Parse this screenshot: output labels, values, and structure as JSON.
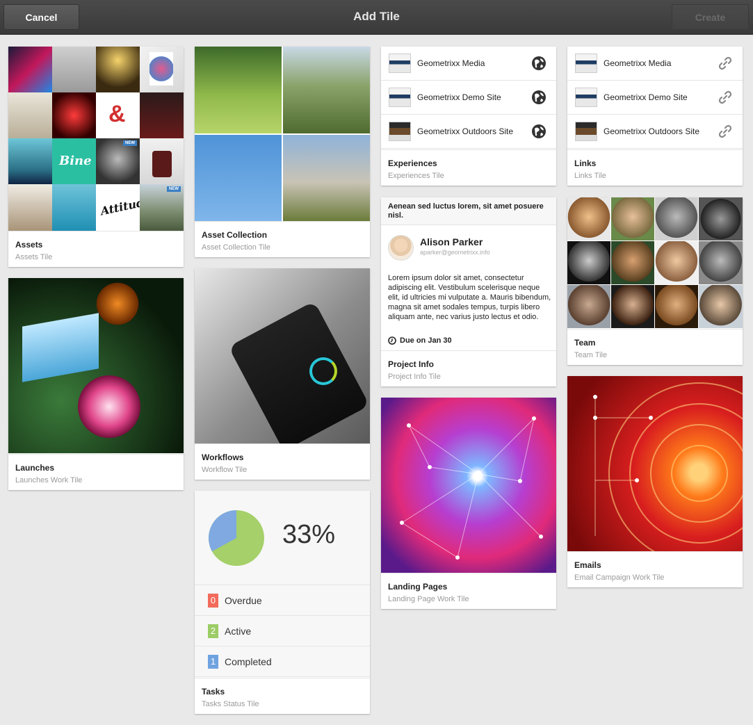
{
  "header": {
    "title": "Add Tile",
    "cancel_label": "Cancel",
    "create_label": "Create"
  },
  "tiles": {
    "assets": {
      "title": "Assets",
      "subtitle": "Assets Tile",
      "badges": [
        "NEW",
        "NEW"
      ]
    },
    "asset_collection": {
      "title": "Asset Collection",
      "subtitle": "Asset Collection Tile"
    },
    "experiences": {
      "title": "Experiences",
      "subtitle": "Experiences Tile",
      "items": [
        {
          "label": "Geometrixx Media",
          "icon": "globe-icon"
        },
        {
          "label": "Geometrixx Demo Site",
          "icon": "globe-icon"
        },
        {
          "label": "Geometrixx Outdoors Site",
          "icon": "globe-icon"
        }
      ]
    },
    "links": {
      "title": "Links",
      "subtitle": "Links Tile",
      "items": [
        {
          "label": "Geometrixx Media",
          "icon": "link-icon"
        },
        {
          "label": "Geometrixx Demo Site",
          "icon": "link-icon"
        },
        {
          "label": "Geometrixx Outdoors Site",
          "icon": "link-icon"
        }
      ]
    },
    "launches": {
      "title": "Launches",
      "subtitle": "Launches Work Tile"
    },
    "workflows": {
      "title": "Workflows",
      "subtitle": "Workflow Tile"
    },
    "project_info": {
      "heading": "Aenean sed luctus lorem, sit amet posuere nisl.",
      "name": "Alison Parker",
      "email": "aparker@geometrixx.info",
      "body": "Lorem ipsum dolor sit amet, consectetur adipiscing elit. Vestibulum scelerisque neque elit, id ultricies mi vulputate a. Mauris bibendum, magna sit amet sodales tempus, turpis libero aliquam ante, nec varius justo lectus et odio.",
      "due": "Due on Jan 30",
      "title": "Project Info",
      "subtitle": "Project Info Tile"
    },
    "team": {
      "title": "Team",
      "subtitle": "Team Tile"
    },
    "landing_pages": {
      "title": "Landing Pages",
      "subtitle": "Landing Page Work Tile"
    },
    "emails": {
      "title": "Emails",
      "subtitle": "Email Campaign Work Tile"
    },
    "tasks": {
      "percent": "33%",
      "pie_fraction": 0.33,
      "rows": [
        {
          "count": "0",
          "label": "Overdue",
          "color": "#f26b5b"
        },
        {
          "count": "2",
          "label": "Active",
          "color": "#9ccc65"
        },
        {
          "count": "1",
          "label": "Completed",
          "color": "#6fa3e0"
        }
      ],
      "title": "Tasks",
      "subtitle": "Tasks Status Tile"
    }
  },
  "colors": {
    "pie_done": "#7fa9e0",
    "pie_remaining": "#a5d06a"
  }
}
